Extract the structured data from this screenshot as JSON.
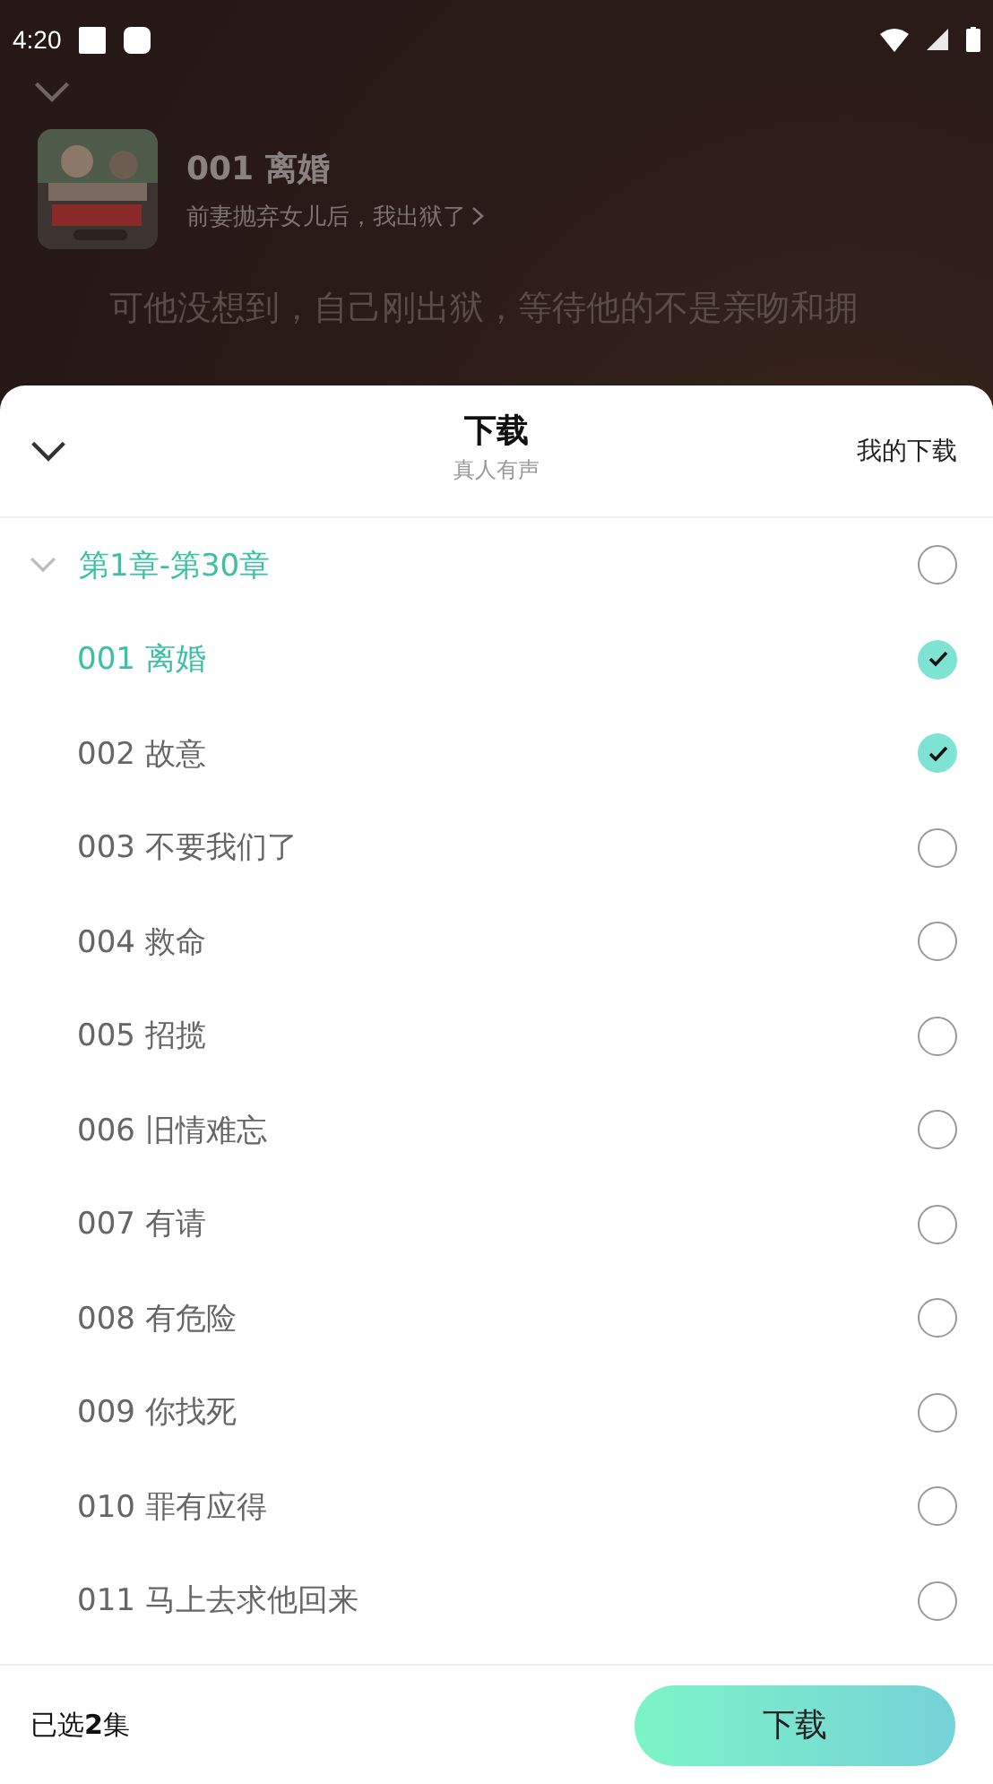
{
  "status_bar": {
    "time": "4:20"
  },
  "player": {
    "episode_title": "001 离婚",
    "book_title": "前妻抛弃女儿后，我出狱了",
    "excerpt_lines": [
      "可他没想到，自己刚出狱，等待他的不是亲吻和拥"
    ]
  },
  "sheet": {
    "title": "下载",
    "subtitle": "真人有声",
    "my_downloads": "我的下载",
    "group": {
      "label": "第1章-第30章",
      "expanded": true,
      "checked": false,
      "chapters": [
        {
          "label": "001 离婚",
          "playing": true,
          "checked": true
        },
        {
          "label": "002 故意",
          "playing": false,
          "checked": true
        },
        {
          "label": "003 不要我们了",
          "playing": false,
          "checked": false
        },
        {
          "label": "004 救命",
          "playing": false,
          "checked": false
        },
        {
          "label": "005 招揽",
          "playing": false,
          "checked": false
        },
        {
          "label": "006 旧情难忘",
          "playing": false,
          "checked": false
        },
        {
          "label": "007 有请",
          "playing": false,
          "checked": false
        },
        {
          "label": "008 有危险",
          "playing": false,
          "checked": false
        },
        {
          "label": "009 你找死",
          "playing": false,
          "checked": false
        },
        {
          "label": "010 罪有应得",
          "playing": false,
          "checked": false
        },
        {
          "label": "011 马上去求他回来",
          "playing": false,
          "checked": false
        }
      ]
    }
  },
  "footer": {
    "selected_count": "已选**2**集",
    "download_button": "下载"
  }
}
